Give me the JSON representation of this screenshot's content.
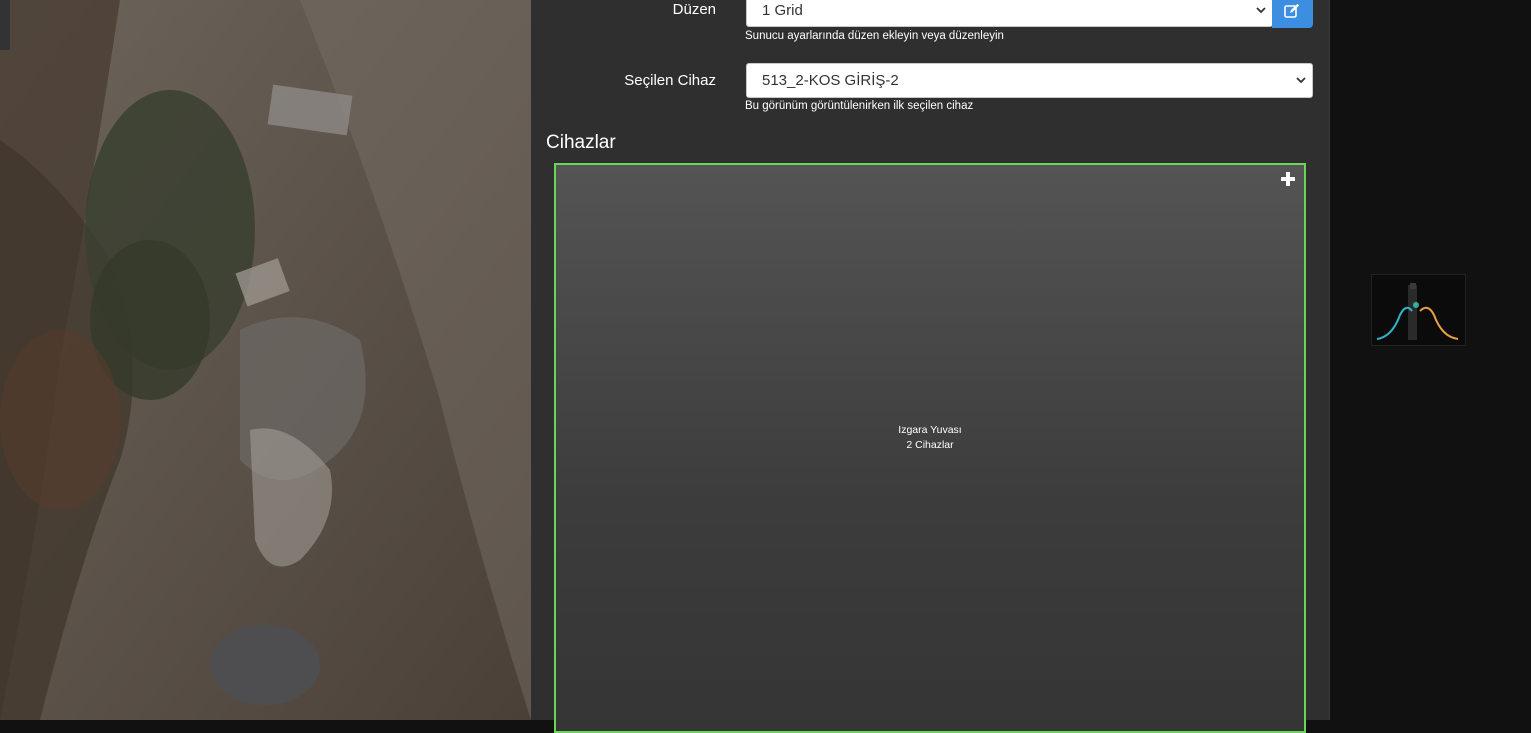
{
  "form": {
    "layout_label": "Düzen",
    "layout_value": "1 Grid",
    "layout_help": "Sunucu ayarlarında düzen ekleyin veya düzenleyin",
    "device_label": "Seçilen Cihaz",
    "device_value": "513_2-KOS GİRİŞ-2",
    "device_help": "Bu görünüm görüntülenirken ilk seçilen cihaz"
  },
  "devices": {
    "title": "Cihazlar",
    "grid_slot_title": "Izgara Yuvası",
    "grid_slot_count": "2 Cihazlar"
  },
  "colors": {
    "panel_bg": "#2f2f2f",
    "accent_blue": "#3c8ee0",
    "grid_border_green": "#6bd55a"
  }
}
